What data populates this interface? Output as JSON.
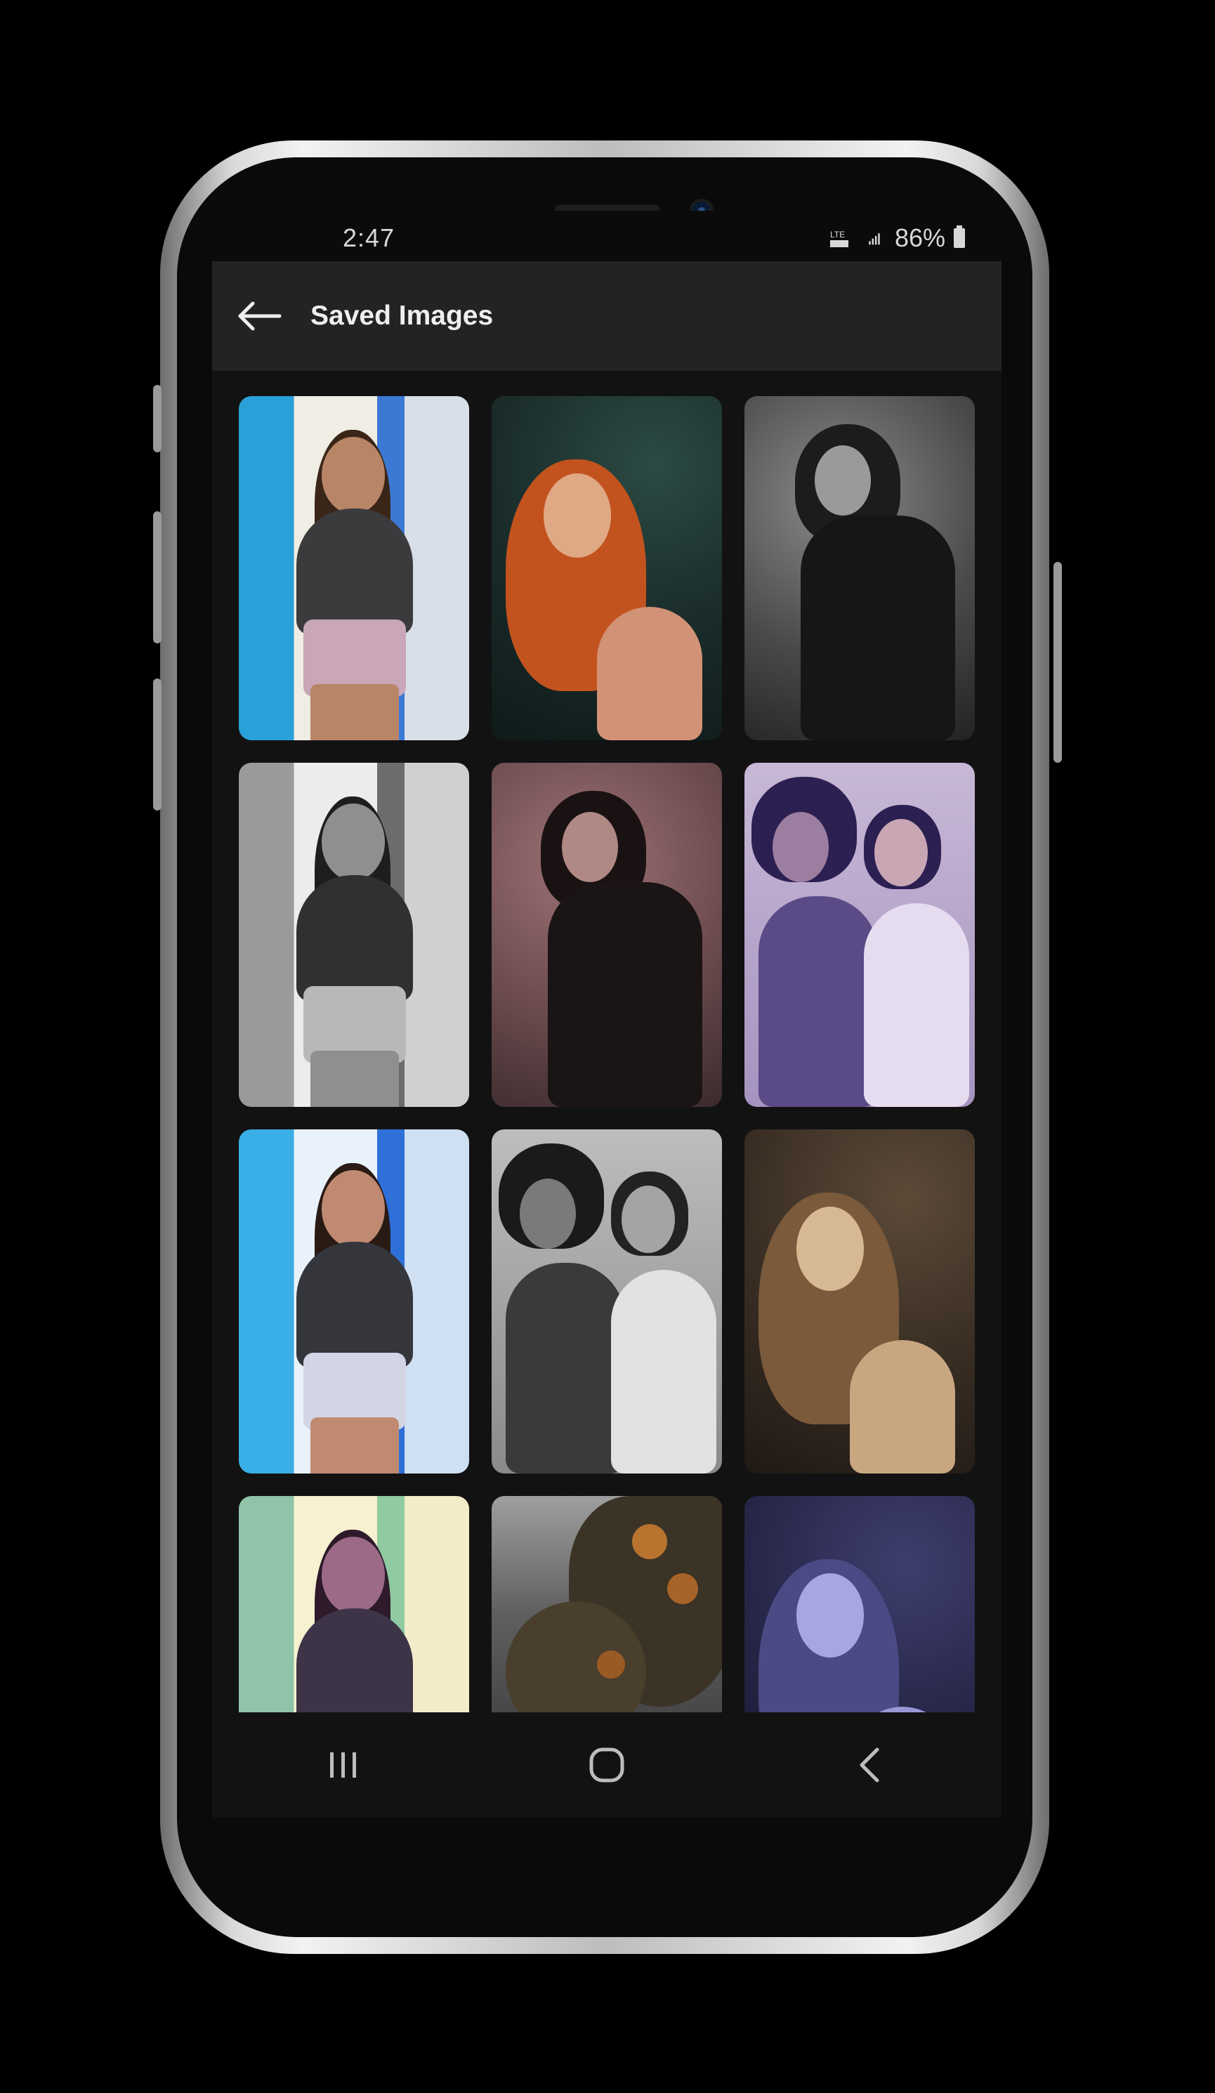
{
  "status_bar": {
    "time": "2:47",
    "battery": "86%",
    "icons": [
      "network-icon",
      "signal-icon",
      "battery-icon"
    ]
  },
  "app_bar": {
    "back_icon": "arrow-left-icon",
    "title": "Saved Images"
  },
  "gallery": {
    "images": [
      {
        "name": "saved-image-1",
        "style": "color"
      },
      {
        "name": "saved-image-2",
        "style": "warm"
      },
      {
        "name": "saved-image-3",
        "style": "bw"
      },
      {
        "name": "saved-image-4",
        "style": "bw"
      },
      {
        "name": "saved-image-5",
        "style": "rose"
      },
      {
        "name": "saved-image-6",
        "style": "violet"
      },
      {
        "name": "saved-image-7",
        "style": "cool"
      },
      {
        "name": "saved-image-8",
        "style": "bw"
      },
      {
        "name": "saved-image-9",
        "style": "sepia"
      },
      {
        "name": "saved-image-10",
        "style": "cream"
      },
      {
        "name": "saved-image-11",
        "style": "foliage"
      },
      {
        "name": "saved-image-12",
        "style": "indigo"
      }
    ]
  },
  "nav_bar": {
    "items": [
      "recent-apps-icon",
      "home-icon",
      "back-chevron-icon"
    ]
  },
  "colors": {
    "screen_background": "#121212",
    "app_bar": "#232323",
    "title_text": "#efefef"
  }
}
